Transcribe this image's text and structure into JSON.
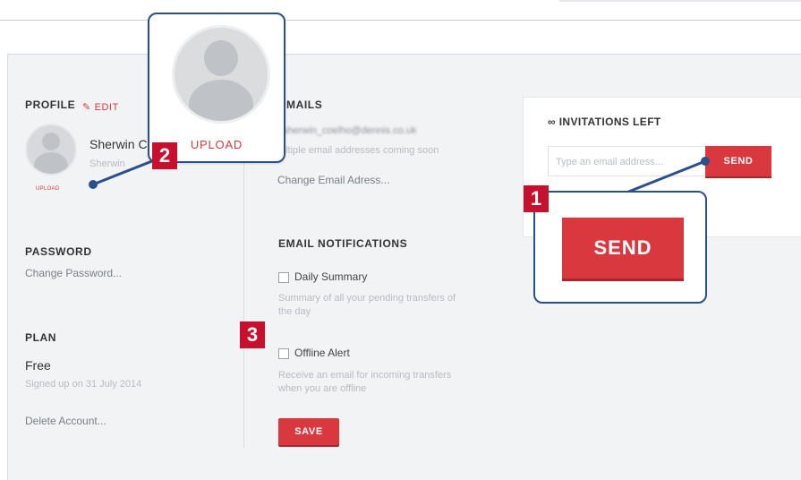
{
  "profile": {
    "title": "PROFILE",
    "edit_label": "EDIT",
    "name": "Sherwin C",
    "subtitle": "Sherwin",
    "upload_label": "UPLOAD"
  },
  "callout_upload": {
    "label": "UPLOAD"
  },
  "badges": {
    "one": "1",
    "two": "2",
    "three": "3"
  },
  "password": {
    "title": "PASSWORD",
    "link": "Change Password..."
  },
  "plan": {
    "title": "PLAN",
    "value": "Free",
    "signed_up": "Signed up on 31 July 2014",
    "delete": "Delete Account..."
  },
  "emails": {
    "title": "MAILS",
    "address": "sherwin_coelho@dennis.co.uk",
    "note": "ultiple email addresses coming soon",
    "change_link": "Change Email Adress..."
  },
  "notifications": {
    "title": "EMAIL NOTIFICATIONS",
    "daily_label": "Daily Summary",
    "daily_desc_1": "Summary of all your pending transfers of",
    "daily_desc_2": "the day",
    "offline_label": "Offline Alert",
    "offline_desc_1": "Receive an email for incoming transfers",
    "offline_desc_2": "when you are offline",
    "save_label": "SAVE"
  },
  "invitations": {
    "title": "INVITATIONS LEFT",
    "count": "∞",
    "placeholder": "Type an email address...",
    "send_label": "SEND"
  },
  "callout_send": {
    "label": "SEND"
  },
  "colors": {
    "accent": "#d9383f",
    "callout_border": "#2b4e8c",
    "badge": "#c8102e"
  }
}
